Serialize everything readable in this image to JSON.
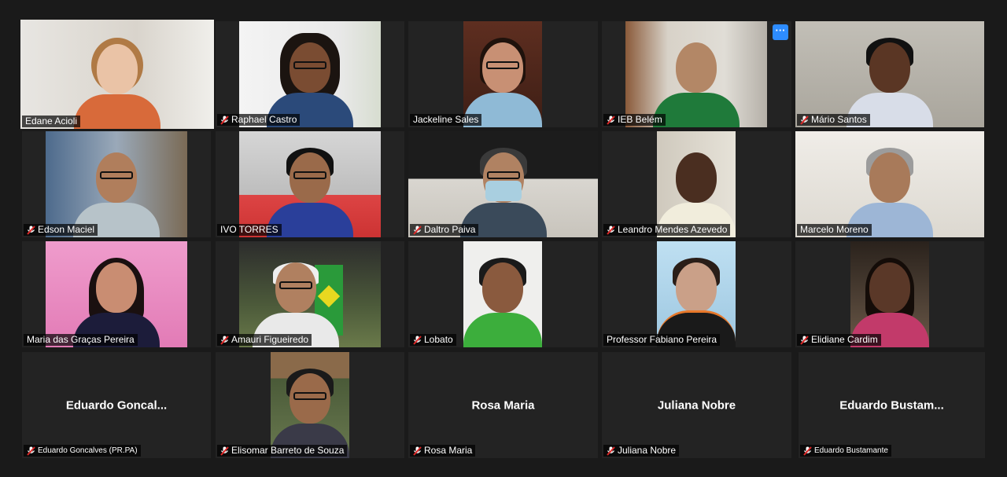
{
  "participants": [
    {
      "name": "Edane Acioli",
      "muted": false
    },
    {
      "name": "Raphael Castro",
      "muted": true
    },
    {
      "name": "Jackeline Sales",
      "muted": false
    },
    {
      "name": "IEB Belém",
      "muted": true
    },
    {
      "name": "Mário Santos",
      "muted": true
    },
    {
      "name": "Edson Maciel",
      "muted": true
    },
    {
      "name": "IVO TORRES",
      "muted": false
    },
    {
      "name": "Daltro Paiva",
      "muted": true
    },
    {
      "name": "Leandro Mendes Azevedo",
      "muted": true
    },
    {
      "name": "Marcelo Moreno",
      "muted": false
    },
    {
      "name": "Maria das Graças Pereira",
      "muted": false
    },
    {
      "name": "Amauri Figueiredo",
      "muted": true
    },
    {
      "name": "Lobato",
      "muted": true
    },
    {
      "name": "Professor Fabiano Pereira",
      "muted": false
    },
    {
      "name": "Elidiane Cardim",
      "muted": true
    },
    {
      "name": "Eduardo Goncalves (PR.PA)",
      "display_name": "Eduardo  Goncal...",
      "muted": true
    },
    {
      "name": "Elisomar Barreto de Souza",
      "muted": true
    },
    {
      "name": "Rosa Maria",
      "display_name": "Rosa Maria",
      "muted": true
    },
    {
      "name": "Juliana Nobre",
      "display_name": "Juliana Nobre",
      "muted": true
    },
    {
      "name": "Eduardo Bustamante",
      "display_name": "Eduardo  Bustam...",
      "muted": true
    }
  ],
  "more_button": {
    "label": "···"
  },
  "colors": {
    "active_speaker_border": "#c8e55c",
    "muted_icon": "#e02828",
    "more_button": "#2d8cff",
    "tile_bg": "#232323",
    "page_bg": "#1a1a1a"
  }
}
